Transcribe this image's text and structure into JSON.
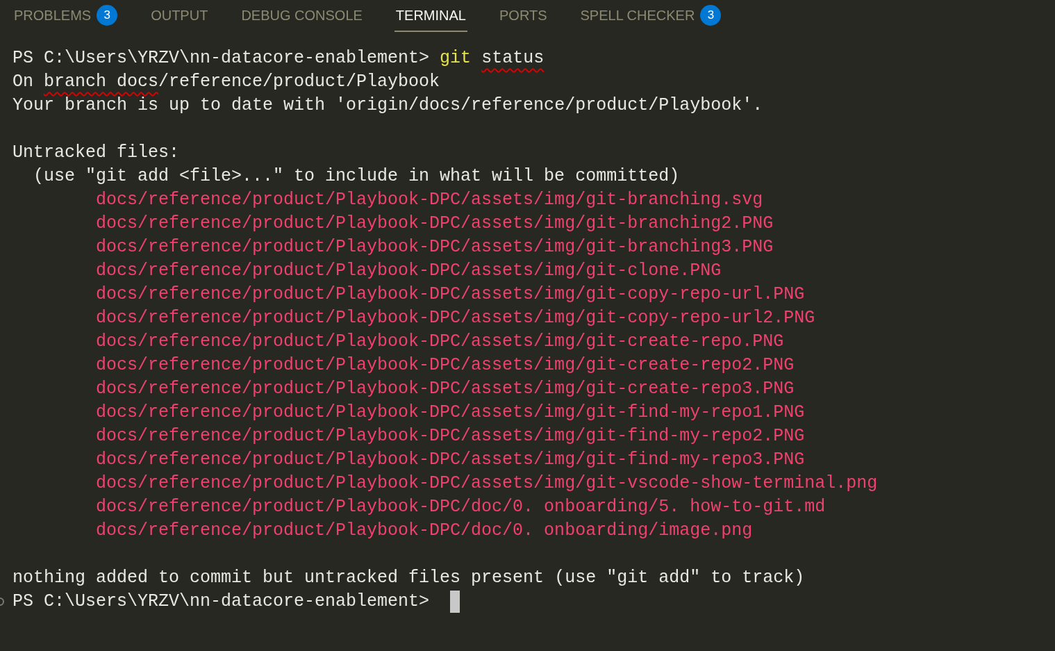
{
  "tabs": [
    {
      "label": "PROBLEMS",
      "selected": false,
      "badge": "3"
    },
    {
      "label": "OUTPUT",
      "selected": false
    },
    {
      "label": "DEBUG CONSOLE",
      "selected": false
    },
    {
      "label": "TERMINAL",
      "selected": true
    },
    {
      "label": "PORTS",
      "selected": false
    },
    {
      "label": "SPELL CHECKER",
      "selected": false,
      "badge": "3"
    }
  ],
  "terminal": {
    "lines": [
      {
        "kind": "command",
        "prompt": "PS C:\\Users\\YRZV\\nn-datacore-enablement>",
        "segments": [
          {
            "text": "git",
            "highlighted": true
          },
          {
            "text": "status",
            "underlined": true
          }
        ]
      },
      {
        "kind": "text",
        "segments": [
          {
            "text": "On "
          },
          {
            "text": "branch docs",
            "underlined": true
          },
          {
            "text": "/reference/product/Playbook"
          }
        ]
      },
      {
        "kind": "text",
        "segments": [
          {
            "text": "Your branch is up to date with 'origin/docs/reference/product/Playbook'."
          }
        ]
      },
      {
        "kind": "blank"
      },
      {
        "kind": "text",
        "segments": [
          {
            "text": "Untracked files:"
          }
        ]
      },
      {
        "kind": "hint",
        "segments": [
          {
            "text": "(use \"git add <file>...\" to include in what will be committed)"
          }
        ]
      },
      {
        "kind": "file",
        "segments": [
          {
            "text": "docs/reference/product/Playbook-DPC/assets/img/git-branching.svg"
          }
        ]
      },
      {
        "kind": "file",
        "segments": [
          {
            "text": "docs/reference/product/Playbook-DPC/assets/img/git-branching2.PNG"
          }
        ]
      },
      {
        "kind": "file",
        "segments": [
          {
            "text": "docs/reference/product/Playbook-DPC/assets/img/git-branching3.PNG"
          }
        ]
      },
      {
        "kind": "file",
        "segments": [
          {
            "text": "docs/reference/product/Playbook-DPC/assets/img/git-clone.PNG"
          }
        ]
      },
      {
        "kind": "file",
        "segments": [
          {
            "text": "docs/reference/product/Playbook-DPC/assets/img/git-copy-repo-url.PNG"
          }
        ]
      },
      {
        "kind": "file",
        "segments": [
          {
            "text": "docs/reference/product/Playbook-DPC/assets/img/git-copy-repo-url2.PNG"
          }
        ]
      },
      {
        "kind": "file",
        "segments": [
          {
            "text": "docs/reference/product/Playbook-DPC/assets/img/git-create-repo.PNG"
          }
        ]
      },
      {
        "kind": "file",
        "segments": [
          {
            "text": "docs/reference/product/Playbook-DPC/assets/img/git-create-repo2.PNG"
          }
        ]
      },
      {
        "kind": "file",
        "segments": [
          {
            "text": "docs/reference/product/Playbook-DPC/assets/img/git-create-repo3.PNG"
          }
        ]
      },
      {
        "kind": "file",
        "segments": [
          {
            "text": "docs/reference/product/Playbook-DPC/assets/img/git-find-my-repo1.PNG"
          }
        ]
      },
      {
        "kind": "file",
        "segments": [
          {
            "text": "docs/reference/product/Playbook-DPC/assets/img/git-find-my-repo2.PNG"
          }
        ]
      },
      {
        "kind": "file",
        "segments": [
          {
            "text": "docs/reference/product/Playbook-DPC/assets/img/git-find-my-repo3.PNG"
          }
        ]
      },
      {
        "kind": "file",
        "segments": [
          {
            "text": "docs/reference/product/Playbook-DPC/assets/img/git-vscode-show-terminal.png"
          }
        ]
      },
      {
        "kind": "file",
        "segments": [
          {
            "text": "docs/reference/product/Playbook-DPC/doc/0. onboarding/5. how-to-git.md"
          }
        ]
      },
      {
        "kind": "file",
        "segments": [
          {
            "text": "docs/reference/product/Playbook-DPC/doc/0. onboarding/image.png"
          }
        ]
      },
      {
        "kind": "blank"
      },
      {
        "kind": "text",
        "segments": [
          {
            "text": "nothing added to commit but untracked files present (use \"git add\" to track)"
          }
        ]
      },
      {
        "kind": "prompt",
        "prompt": "PS C:\\Users\\YRZV\\nn-datacore-enablement>",
        "cursor": true
      }
    ]
  }
}
